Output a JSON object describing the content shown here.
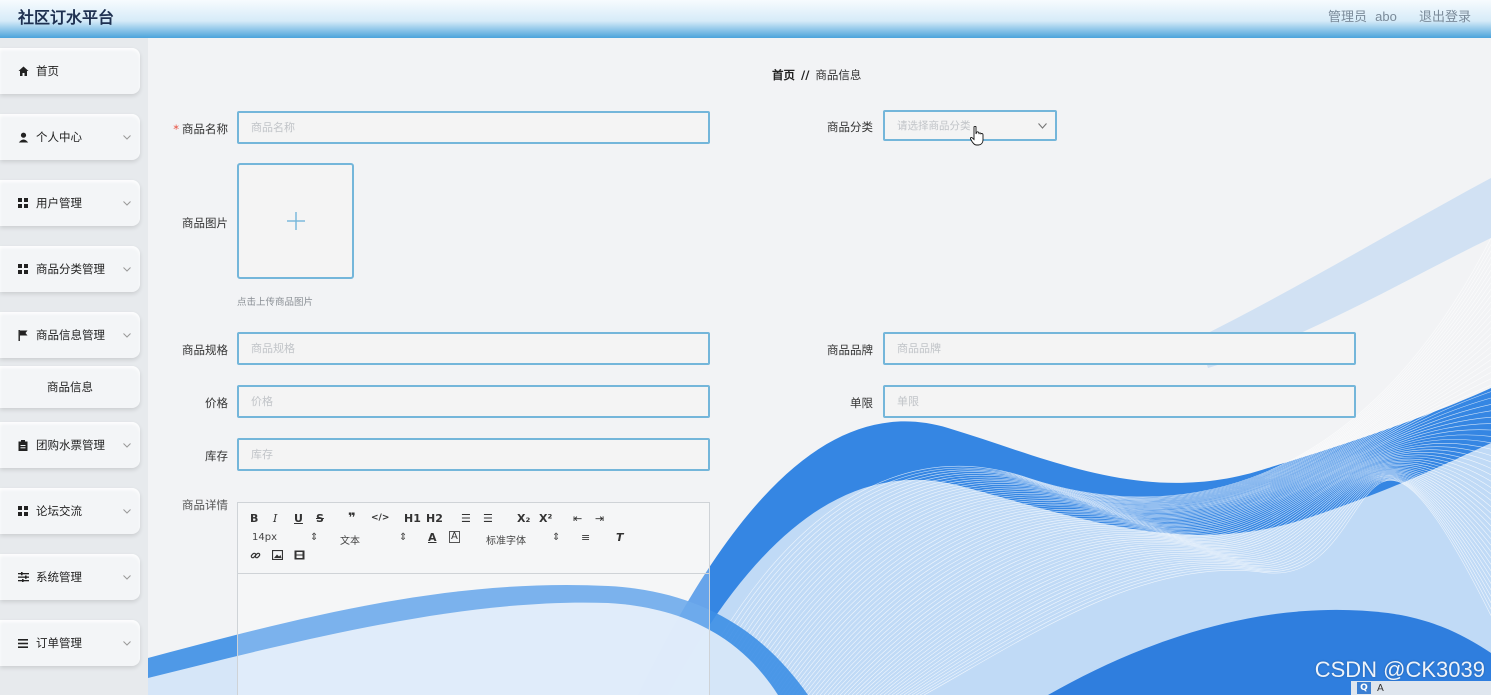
{
  "app": {
    "title": "社区订水平台"
  },
  "user": {
    "role": "管理员",
    "name": "abo",
    "logout": "退出登录"
  },
  "sidebar": {
    "items": [
      {
        "label": "首页",
        "icon": "home-icon"
      },
      {
        "label": "个人中心",
        "icon": "user-icon"
      },
      {
        "label": "用户管理",
        "icon": "grid-icon"
      },
      {
        "label": "商品分类管理",
        "icon": "grid-icon"
      },
      {
        "label": "商品信息管理",
        "icon": "flag-icon"
      },
      {
        "label": "商品信息",
        "icon": ""
      },
      {
        "label": "团购水票管理",
        "icon": "clipboard-icon"
      },
      {
        "label": "论坛交流",
        "icon": "grid-icon"
      },
      {
        "label": "系统管理",
        "icon": "sliders-icon"
      },
      {
        "label": "订单管理",
        "icon": "list-icon"
      }
    ]
  },
  "breadcrumb": {
    "home": "首页",
    "sep": "//",
    "current": "商品信息"
  },
  "form": {
    "name": {
      "label": "商品名称",
      "placeholder": "商品名称"
    },
    "category": {
      "label": "商品分类",
      "placeholder": "请选择商品分类"
    },
    "image": {
      "label": "商品图片",
      "tip": "点击上传商品图片"
    },
    "spec": {
      "label": "商品规格",
      "placeholder": "商品规格"
    },
    "brand": {
      "label": "商品品牌",
      "placeholder": "商品品牌"
    },
    "price": {
      "label": "价格",
      "placeholder": "价格"
    },
    "limit": {
      "label": "单限",
      "placeholder": "单限"
    },
    "stock": {
      "label": "库存",
      "placeholder": "库存"
    },
    "detail": {
      "label": "商品详情"
    }
  },
  "editor": {
    "font_size": "14px",
    "paragraph": "文本",
    "font_family": "标准字体",
    "h1": "H1",
    "h2": "H2",
    "sub": "X₂",
    "sup": "X²"
  },
  "watermark": "CSDN @CK3039",
  "colors": {
    "accent": "#74b6da",
    "wave": "#1e7be0",
    "topbar": "#4ba3db"
  }
}
